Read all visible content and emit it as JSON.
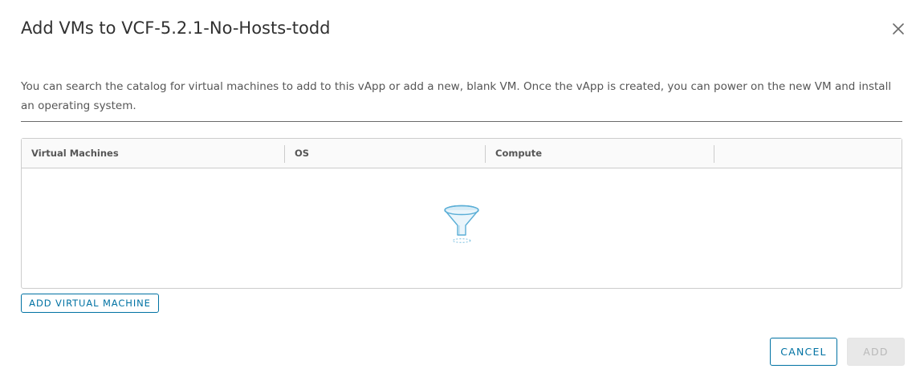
{
  "dialog": {
    "title": "Add VMs to VCF-5.2.1-No-Hosts-todd",
    "close_icon": "close-icon",
    "description": "You can search the catalog for virtual machines to add to this vApp or add a new, blank VM. Once the vApp is created, you can power on the new VM and install an operating system."
  },
  "grid": {
    "columns": [
      "Virtual Machines",
      "OS",
      "Compute",
      ""
    ],
    "rows": [],
    "empty_icon": "filter-funnel-icon"
  },
  "actions": {
    "add_vm_label": "ADD VIRTUAL MACHINE",
    "cancel_label": "CANCEL",
    "add_label": "ADD",
    "add_disabled": true
  },
  "colors": {
    "accent": "#0072a3",
    "disabled_bg": "#e8e8e8",
    "disabled_text": "#b9b9b9"
  }
}
